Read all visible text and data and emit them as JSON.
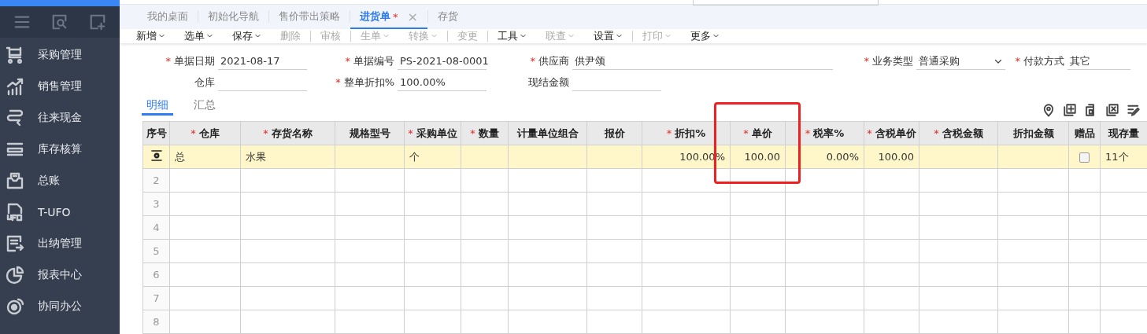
{
  "sidebar": {
    "items": [
      {
        "label": "采购管理"
      },
      {
        "label": "销售管理"
      },
      {
        "label": "往来现金"
      },
      {
        "label": "库存核算"
      },
      {
        "label": "总账"
      },
      {
        "label": "T-UFO"
      },
      {
        "label": "出纳管理"
      },
      {
        "label": "报表中心"
      },
      {
        "label": "协同办公"
      }
    ]
  },
  "tabs": [
    {
      "label": "我的桌面",
      "selected": false
    },
    {
      "label": "初始化导航",
      "selected": false
    },
    {
      "label": "售价带出策略",
      "selected": false
    },
    {
      "label": "进货单",
      "selected": true,
      "marker": "*",
      "close_label": "×"
    },
    {
      "label": "存货",
      "selected": false
    }
  ],
  "toolbar": [
    {
      "label": "新增",
      "dropdown": true,
      "disabled": false,
      "separator_before": false
    },
    {
      "label": "选单",
      "dropdown": true,
      "disabled": false,
      "separator_before": false
    },
    {
      "label": "保存",
      "dropdown": true,
      "disabled": false,
      "separator_before": false
    },
    {
      "label": "删除",
      "dropdown": false,
      "disabled": true,
      "separator_before": false
    },
    {
      "label": "审核",
      "dropdown": false,
      "disabled": true,
      "separator_before": true
    },
    {
      "label": "生单",
      "dropdown": true,
      "disabled": true,
      "separator_before": true
    },
    {
      "label": "转换",
      "dropdown": true,
      "disabled": true,
      "separator_before": false
    },
    {
      "label": "变更",
      "dropdown": false,
      "disabled": true,
      "separator_before": true
    },
    {
      "label": "工具",
      "dropdown": true,
      "disabled": false,
      "separator_before": true
    },
    {
      "label": "联查",
      "dropdown": true,
      "disabled": true,
      "separator_before": false
    },
    {
      "label": "设置",
      "dropdown": true,
      "disabled": false,
      "separator_before": false
    },
    {
      "label": "打印",
      "dropdown": true,
      "disabled": true,
      "separator_before": true
    },
    {
      "label": "更多",
      "dropdown": true,
      "disabled": false,
      "separator_before": false
    }
  ],
  "form": {
    "rows": [
      [
        {
          "label": "单据日期",
          "marker": "*",
          "kind": "text",
          "value": "2021-08-17"
        },
        {
          "label": "单据编号",
          "marker": "*",
          "kind": "text",
          "value": "PS-2021-08-0001"
        },
        {
          "label": "供应商",
          "marker": "*",
          "kind": "text",
          "value": "供尹颂"
        },
        {
          "label": "业务类型",
          "marker": "*",
          "kind": "select",
          "value": "普通采购"
        },
        {
          "label": "付款方式",
          "marker": "*",
          "kind": "text",
          "value": "其它"
        }
      ],
      [
        {
          "label": "仓库",
          "kind": "text"
        },
        {
          "label": "整单折扣%",
          "marker": "*",
          "kind": "text",
          "value": "100.00%"
        },
        {
          "label": "现结金额",
          "kind": "text"
        }
      ]
    ]
  },
  "subtabs": [
    {
      "label": "明细",
      "selected": true
    },
    {
      "label": "汇总",
      "selected": false
    }
  ],
  "table": {
    "columns": [
      {
        "label": "序号",
        "kind": "index",
        "highlighted": false
      },
      {
        "label": "仓库",
        "marker": "*",
        "kind": "text",
        "highlighted": false
      },
      {
        "label": "存货名称",
        "marker": "*",
        "kind": "text",
        "highlighted": false
      },
      {
        "label": "规格型号",
        "kind": "text",
        "highlighted": false
      },
      {
        "label": "采购单位",
        "marker": "*",
        "kind": "text",
        "highlighted": false
      },
      {
        "label": "数量",
        "marker": "*",
        "kind": "number",
        "highlighted": false
      },
      {
        "label": "计量单位组合",
        "kind": "text",
        "highlighted": false
      },
      {
        "label": "报价",
        "kind": "number",
        "highlighted": false
      },
      {
        "label": "折扣%",
        "marker": "*",
        "kind": "number",
        "highlighted": false
      },
      {
        "label": "单价",
        "marker": "*",
        "kind": "number",
        "highlighted": true
      },
      {
        "label": "税率%",
        "marker": "*",
        "kind": "number",
        "highlighted": false
      },
      {
        "label": "含税单价",
        "marker": "*",
        "kind": "number",
        "highlighted": false
      },
      {
        "label": "含税金额",
        "marker": "*",
        "kind": "number",
        "highlighted": false
      },
      {
        "label": "折扣金额",
        "kind": "number",
        "highlighted": false
      },
      {
        "label": "赠品",
        "kind": "checkbox",
        "highlighted": false
      },
      {
        "label": "现存量",
        "kind": "text",
        "highlighted": false
      }
    ],
    "rows": [
      {
        "editing": true,
        "cells": [
          "总",
          "水果",
          null,
          "个",
          null,
          null,
          null,
          "100.00%",
          "100.00",
          "0.00%",
          "100.00",
          null,
          null,
          {
            "checked": false
          },
          "11个"
        ]
      },
      {
        "editing": false,
        "number": "2"
      },
      {
        "editing": false,
        "number": "3"
      },
      {
        "editing": false,
        "number": "4"
      },
      {
        "editing": false,
        "number": "5"
      },
      {
        "editing": false,
        "number": "6"
      },
      {
        "editing": false,
        "number": "7"
      },
      {
        "editing": false,
        "number": "8"
      }
    ]
  }
}
